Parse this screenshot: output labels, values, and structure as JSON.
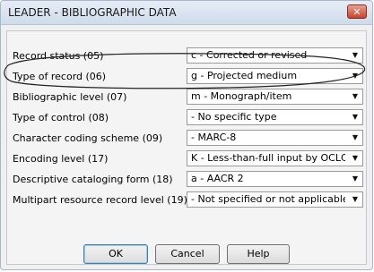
{
  "dialog": {
    "title": "LEADER - BIBLIOGRAPHIC DATA",
    "close_glyph": "✕"
  },
  "fields": [
    {
      "label": "Record status (05)",
      "value": "c - Corrected or revised"
    },
    {
      "label": "Type of record (06)",
      "value": "g - Projected medium"
    },
    {
      "label": "Bibliographic level (07)",
      "value": "m - Monograph/item"
    },
    {
      "label": "Type of control (08)",
      "value": "- No specific type"
    },
    {
      "label": "Character coding scheme (09)",
      "value": "- MARC-8"
    },
    {
      "label": "Encoding level (17)",
      "value": "K - Less-than-full input by OCLC par"
    },
    {
      "label": "Descriptive cataloging form (18)",
      "value": "a - AACR 2"
    },
    {
      "label": "Multipart resource record level (19)",
      "value": "- Not specified or not applicable"
    }
  ],
  "buttons": {
    "ok_label": "OK",
    "cancel_label": "Cancel",
    "help_label": "Help"
  },
  "icons": {
    "dropdown_arrow": "▼"
  },
  "colors": {
    "close_button": "#c9412b",
    "titlebar": "#cfdbea"
  }
}
